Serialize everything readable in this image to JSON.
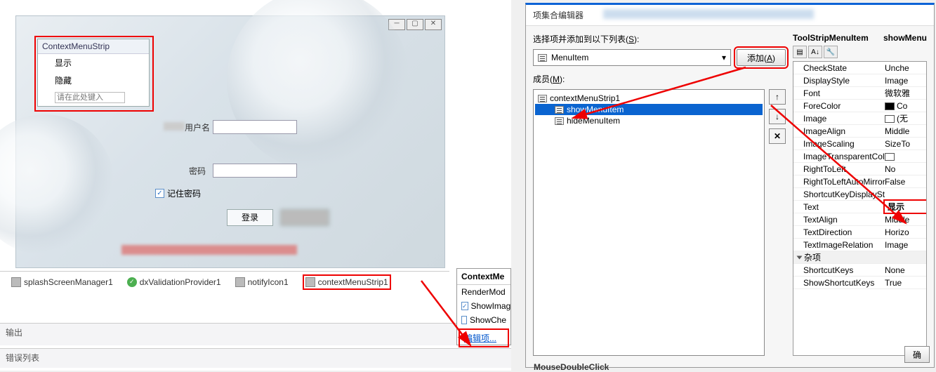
{
  "form": {
    "ctx_header": "ContextMenuStrip",
    "ctx_show": "显示",
    "ctx_hide": "隐藏",
    "ctx_placeholder": "请在此处键入",
    "username": "用户名",
    "password": "密码",
    "remember": "记住密码",
    "login": "登录"
  },
  "tray": {
    "splash": "splashScreenManager1",
    "dxv": "dxValidationProvider1",
    "notify": "notifyIcon1",
    "ctx": "contextMenuStrip1"
  },
  "output_label": "输出",
  "errorlist_label": "错误列表",
  "smarttag": {
    "title": "ContextMe",
    "rendermode": "RenderMod",
    "showimage": "ShowImag",
    "showcheck": "ShowChe",
    "edit_items": "编辑项..."
  },
  "dialog": {
    "title": "项集合编辑器",
    "select_label": "选择项并添加到以下列表(S):",
    "combo_value": "MenuItem",
    "add_btn": "添加(A)",
    "members_label": "成员(M):",
    "tree": {
      "root": "contextMenuStrip1",
      "item1": "showMenuItem",
      "item2": "hideMenuItem"
    },
    "prop_header_type": "ToolStripMenuItem",
    "prop_header_name": "showMenu",
    "props": [
      {
        "n": "CheckState",
        "v": "Unche"
      },
      {
        "n": "DisplayStyle",
        "v": "Image"
      },
      {
        "n": "Font",
        "v": "微软雅"
      },
      {
        "n": "ForeColor",
        "v": "Co",
        "chip": "#000"
      },
      {
        "n": "Image",
        "v": "(无",
        "chip": "#fff"
      },
      {
        "n": "ImageAlign",
        "v": "Middle"
      },
      {
        "n": "ImageScaling",
        "v": "SizeTo"
      },
      {
        "n": "ImageTransparentColor",
        "v": "",
        "chip": "#fff"
      },
      {
        "n": "RightToLeft",
        "v": "No"
      },
      {
        "n": "RightToLeftAutoMirrorI",
        "v": "False"
      },
      {
        "n": "ShortcutKeyDisplayStrin",
        "v": ""
      },
      {
        "n": "Text",
        "v": "显示",
        "hl": true
      },
      {
        "n": "TextAlign",
        "v": "Middle"
      },
      {
        "n": "TextDirection",
        "v": "Horizo"
      },
      {
        "n": "TextImageRelation",
        "v": "Image"
      }
    ],
    "cat_misc": "杂项",
    "misc": [
      {
        "n": "ShortcutKeys",
        "v": "None"
      },
      {
        "n": "ShowShortcutKeys",
        "v": "True"
      }
    ],
    "ok": "确"
  },
  "footer_event": "MouseDoubleClick"
}
